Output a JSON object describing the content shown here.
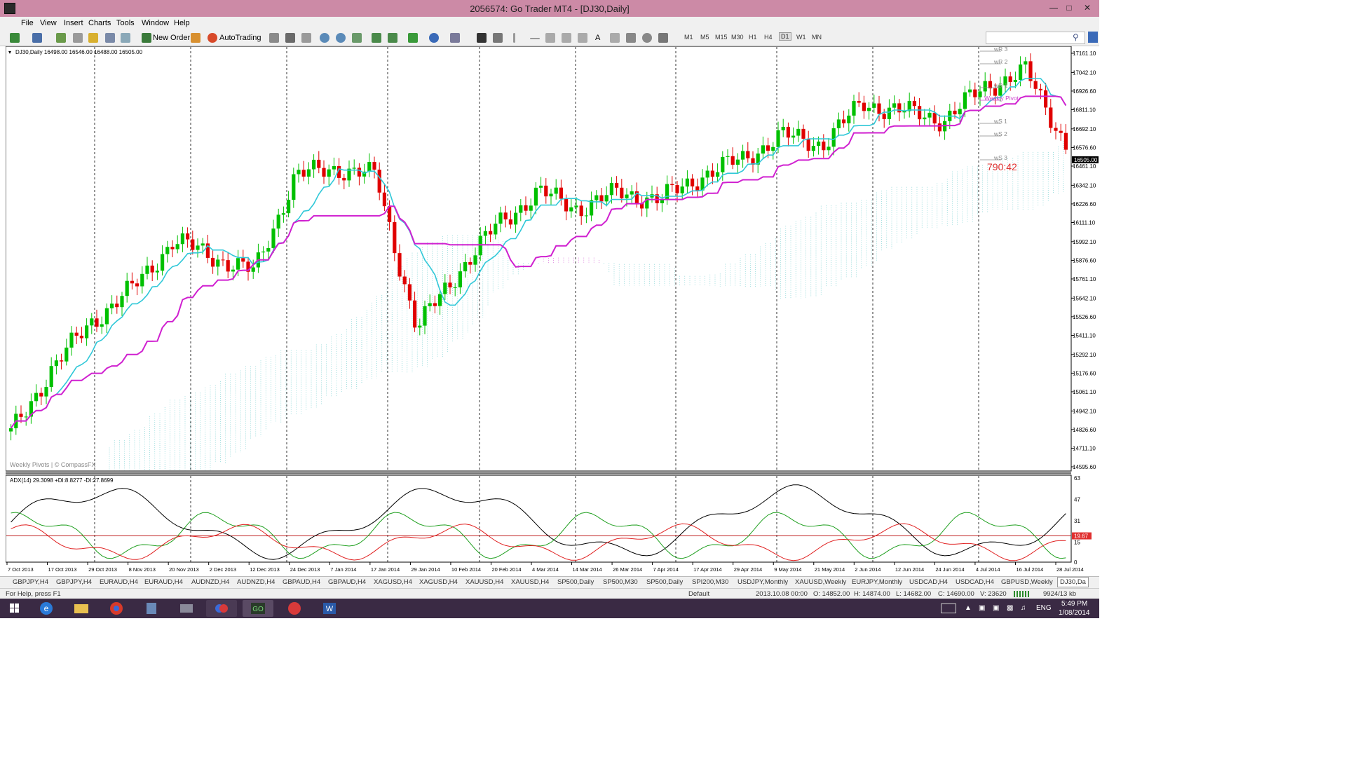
{
  "window": {
    "title": "2056574: Go Trader MT4 - [DJ30,Daily]"
  },
  "menu": [
    "File",
    "View",
    "Insert",
    "Charts",
    "Tools",
    "Window",
    "Help"
  ],
  "toolbar": {
    "new_order": "New Order",
    "autotrading": "AutoTrading",
    "timeframes": [
      "M1",
      "M5",
      "M15",
      "M30",
      "H1",
      "H4",
      "D1",
      "W1",
      "MN"
    ],
    "active_timeframe": "D1"
  },
  "chart": {
    "header": "DJ30,Daily  16498.00 16546.00 16488.00 16505.00",
    "watermark": "Weekly Pivots | © CompassFX",
    "countdown": "790:42",
    "current_price_label": "16505.00",
    "pivot_labels": [
      "wR 3",
      "wR 2",
      "wR 1",
      "Weekly Pivot",
      "wS 1",
      "wS 2",
      "wS 3"
    ],
    "price_axis": [
      "17161.10",
      "17042.10",
      "16926.60",
      "16811.10",
      "16692.10",
      "16576.60",
      "16461.10",
      "16342.10",
      "16226.60",
      "16111.10",
      "15992.10",
      "15876.60",
      "15761.10",
      "15642.10",
      "15526.60",
      "15411.10",
      "15292.10",
      "15176.60",
      "15061.10",
      "14942.10",
      "14826.60",
      "14711.10",
      "14595.60"
    ],
    "date_axis": [
      "7 Oct 2013",
      "17 Oct 2013",
      "29 Oct 2013",
      "8 Nov 2013",
      "20 Nov 2013",
      "2 Dec 2013",
      "12 Dec 2013",
      "24 Dec 2013",
      "7 Jan 2014",
      "17 Jan 2014",
      "29 Jan 2014",
      "10 Feb 2014",
      "20 Feb 2014",
      "4 Mar 2014",
      "14 Mar 2014",
      "26 Mar 2014",
      "7 Apr 2014",
      "17 Apr 2014",
      "29 Apr 2014",
      "9 May 2014",
      "21 May 2014",
      "2 Jun 2014",
      "12 Jun 2014",
      "24 Jun 2014",
      "4 Jul 2014",
      "16 Jul 2014",
      "28 Jul 2014"
    ],
    "indicator": {
      "header": "ADX(14) 29.3098 +DI:8.8277 -DI:27.8699",
      "axis": [
        "63",
        "47",
        "31",
        "19.67",
        "15",
        "0"
      ],
      "level": "19.67"
    }
  },
  "chart_data": {
    "type": "line",
    "title": "DJ30,Daily",
    "x": [
      "7 Oct 2013",
      "17 Oct 2013",
      "29 Oct 2013",
      "8 Nov 2013",
      "20 Nov 2013",
      "2 Dec 2013",
      "12 Dec 2013",
      "24 Dec 2013",
      "7 Jan 2014",
      "17 Jan 2014",
      "29 Jan 2014",
      "10 Feb 2014",
      "20 Feb 2014",
      "4 Mar 2014",
      "14 Mar 2014",
      "26 Mar 2014",
      "7 Apr 2014",
      "17 Apr 2014",
      "29 Apr 2014",
      "9 May 2014",
      "21 May 2014",
      "2 Jun 2014",
      "12 Jun 2014",
      "24 Jun 2014",
      "4 Jul 2014",
      "16 Jul 2014",
      "28 Jul 2014"
    ],
    "series": [
      {
        "values": [
          14800,
          15200,
          15500,
          15700,
          16000,
          15900,
          15800,
          16400,
          16450,
          16400,
          15450,
          15800,
          16100,
          16300,
          16200,
          16300,
          16250,
          16400,
          16500,
          16650,
          16600,
          16850,
          16800,
          16750,
          16950,
          17050,
          16600
        ]
      }
    ],
    "ylim": [
      14595.6,
      17161.1
    ],
    "indicator_ylim": [
      0,
      63
    ]
  },
  "tabs": [
    "GBPJPY,H4",
    "GBPJPY,H4",
    "EURAUD,H4",
    "EURAUD,H4",
    "AUDNZD,H4",
    "AUDNZD,H4",
    "GBPAUD,H4",
    "GBPAUD,H4",
    "XAGUSD,H4",
    "XAGUSD,H4",
    "XAUUSD,H4",
    "XAUUSD,H4",
    "SP500,Daily",
    "SP500,M30",
    "SP500,Daily",
    "SPI200,M30",
    "USDJPY,Monthly",
    "XAUUSD,Weekly",
    "EURJPY,Monthly",
    "USDCAD,H4",
    "USDCAD,H4",
    "GBPUSD,Weekly",
    "DJ30,Da"
  ],
  "status": {
    "help": "For Help, press F1",
    "profile": "Default",
    "datetime": "2013.10.08 00:00",
    "open": "O: 14852.00",
    "high": "H: 14874.00",
    "low": "L: 14682.00",
    "close": "C: 14690.00",
    "volume": "V: 23620",
    "traffic": "9924/13 kb"
  },
  "taskbar": {
    "lang": "ENG",
    "time": "5:49 PM",
    "date": "1/08/2014"
  }
}
